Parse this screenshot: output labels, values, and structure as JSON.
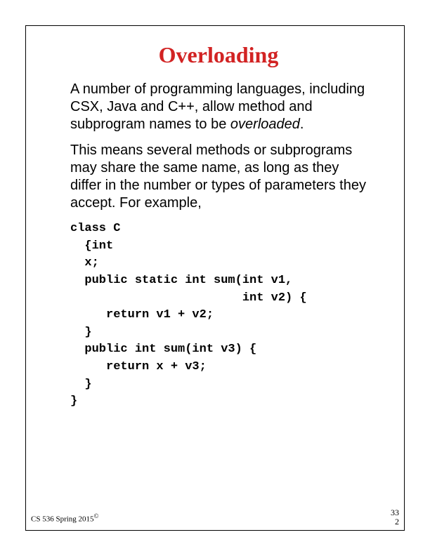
{
  "title": "Overloading",
  "para1_a": "A number of programming languages, including CSX, Java and C++, allow method and subprogram names to be ",
  "para1_b": "overloaded",
  "para1_c": ".",
  "para2": "This means several methods or subprograms may share the same name, as long as they differ in the number or types of parameters they accept. For example,",
  "code": "class C\n  {int\n  x;\n  public static int sum(int v1,\n                        int v2) {\n     return v1 + v2;\n  }\n  public int sum(int v3) {\n     return x + v3;\n  }\n}",
  "footer_left": "CS 536  Spring 2015",
  "copyright": "©",
  "footer_right_top": "33",
  "footer_right_bottom": "2"
}
